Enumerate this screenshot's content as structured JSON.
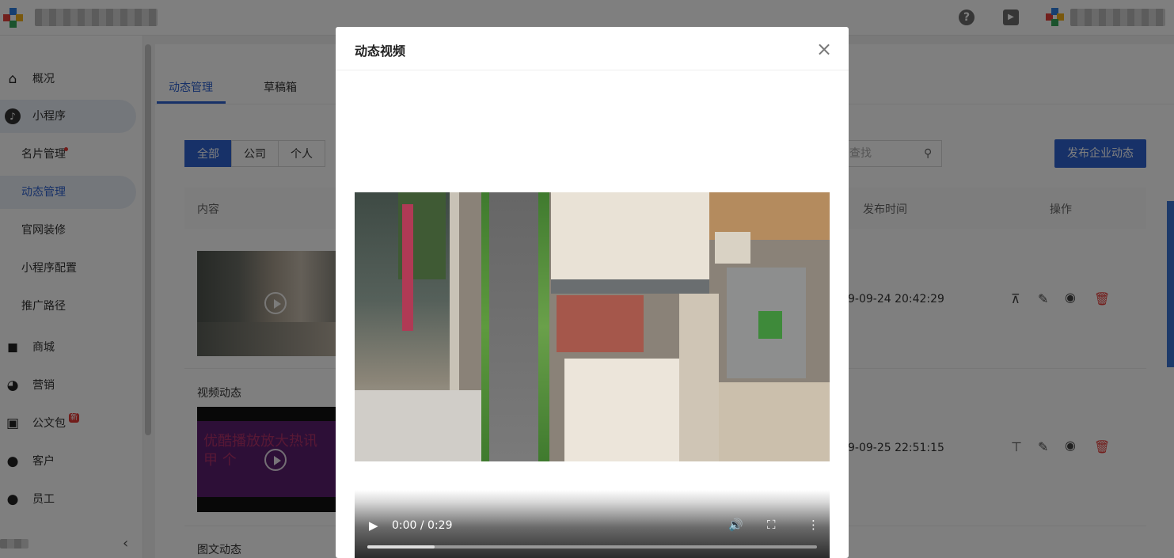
{
  "sidebar": {
    "items": [
      {
        "label": "概况",
        "icon": "home-icon"
      },
      {
        "label": "小程序",
        "icon": "miniprogram-icon"
      },
      {
        "label": "名片管理"
      },
      {
        "label": "动态管理"
      },
      {
        "label": "官网装修"
      },
      {
        "label": "小程序配置"
      },
      {
        "label": "推广路径"
      },
      {
        "label": "商城",
        "icon": "shopping-bag-icon"
      },
      {
        "label": "营销",
        "icon": "pie-chart-icon"
      },
      {
        "label": "公文包",
        "icon": "briefcase-icon",
        "badge": "新"
      },
      {
        "label": "客户",
        "icon": "customer-icon"
      },
      {
        "label": "员工",
        "icon": "employee-icon"
      }
    ],
    "collapse_icon": "chevron-left-icon"
  },
  "tabs": {
    "manage": "动态管理",
    "drafts": "草稿箱"
  },
  "filters": {
    "all": "全部",
    "company": "公司",
    "personal": "个人"
  },
  "search": {
    "placeholder": "查找"
  },
  "publish_button": "发布企业动态",
  "table": {
    "headers": {
      "content": "内容",
      "time": "发布时间",
      "actions": "操作"
    },
    "rows": [
      {
        "type_label": "",
        "time": "9-09-24 20:42:29",
        "pin_icon": "unpin-icon"
      },
      {
        "type_label": "视频动态",
        "time": "9-09-25 22:51:15",
        "pin_icon": "pin-top-icon"
      },
      {
        "type_label": "图文动态"
      }
    ],
    "thumb_text": "优酷播放放大热讯\n甲 个"
  },
  "modal": {
    "title": "动态视频",
    "player": {
      "time": "0:00 / 0:29",
      "progress": 0.15
    }
  },
  "colors": {
    "accent": "#2f62d1",
    "danger": "#e53935"
  }
}
